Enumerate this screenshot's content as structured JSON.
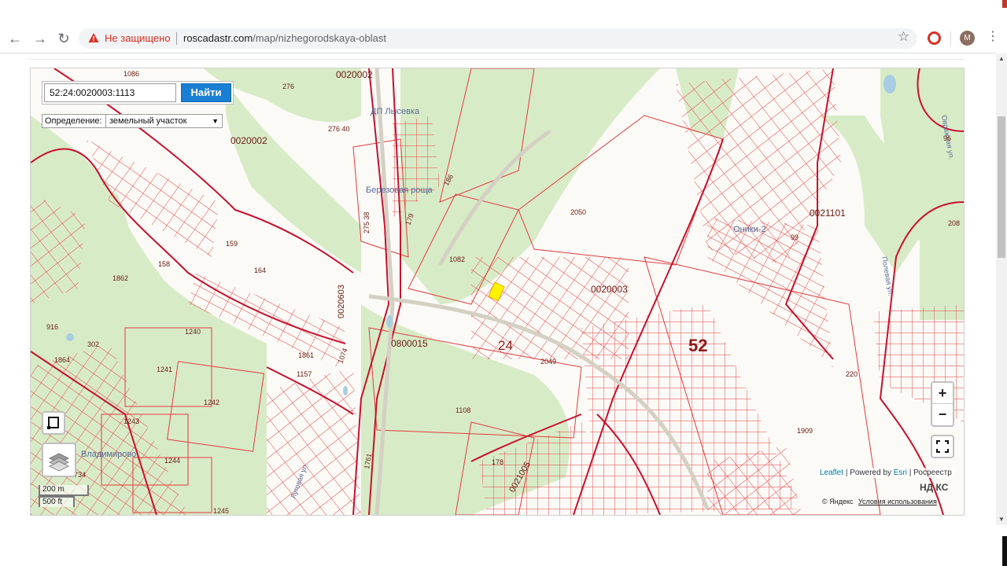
{
  "browser": {
    "insecure_label": "Не защищено",
    "url_host": "roscadastr.com",
    "url_path": "/map/nizhegorodskaya-oblast",
    "avatar_letter": "M",
    "back_icon": "arrow-left-icon",
    "forward_icon": "arrow-right-icon",
    "reload_icon": "reload-icon",
    "star_icon": "star-icon",
    "menu_icon": "kebab-icon"
  },
  "search": {
    "value": "52:24:0020003:1113",
    "button_label": "Найти"
  },
  "definition": {
    "label": "Определение:",
    "selected": "земельный участок"
  },
  "controls": {
    "zoom_in": "+",
    "zoom_out": "−",
    "fullscreen_icon": "fullscreen-icon",
    "draw_icon": "polygon-draw-icon",
    "layers_icon": "layers-icon"
  },
  "scale": {
    "metric": "200 m",
    "imperial": "500 ft"
  },
  "attribution": {
    "leaflet": "Leaflet",
    "powered": "| Powered by",
    "esri": "Esri",
    "rosreestr": "| Росреестр",
    "yandex": "© Яндекс",
    "terms": "Условия использования",
    "yandex_maps": "НД КС"
  },
  "map_labels": {
    "district": "52",
    "region_24": "24",
    "quarter_0020003": "0020003",
    "quarter_0020002_top": "0020002",
    "quarter_0020002_left": "0020002",
    "quarter_0800015": "0800015",
    "quarter_0021101": "0021101",
    "quarter_0020603": "0020603",
    "quarter_0021005": "0021005",
    "place_lysevka": "ДП Лысевка",
    "place_berezovaya": "Березовая роща",
    "place_oniki": "Оники-2",
    "place_vladimirovo": "Владимирово",
    "street_lugovaya": "Луговая ул.",
    "street_polevaya": "Полевая ул.",
    "street_ovrazh": "Овражная ул.",
    "p2050": "2050",
    "p1082": "1082",
    "p1108": "1108",
    "p1909": "1909",
    "p2049": "2049",
    "p1862": "1862",
    "p1240": "1240",
    "p1241": "1241",
    "p1242": "1242",
    "p1243": "1243",
    "p1244": "1244",
    "p1157": "1157",
    "p1861": "1861",
    "p1074": "1074",
    "p178": "178",
    "p276": "276",
    "p27640": "276 40",
    "p158": "158",
    "p164": "164",
    "p159": "159",
    "p1864": "1864",
    "p302": "302",
    "p916": "916",
    "p208": "208",
    "p220": "220",
    "p1086": "1086",
    "p1761": "1761",
    "p99": "99",
    "p96": "96",
    "p186": "186",
    "p179": "179",
    "p27538": "275 38",
    "p1734": "1734",
    "p1245": "1245"
  }
}
